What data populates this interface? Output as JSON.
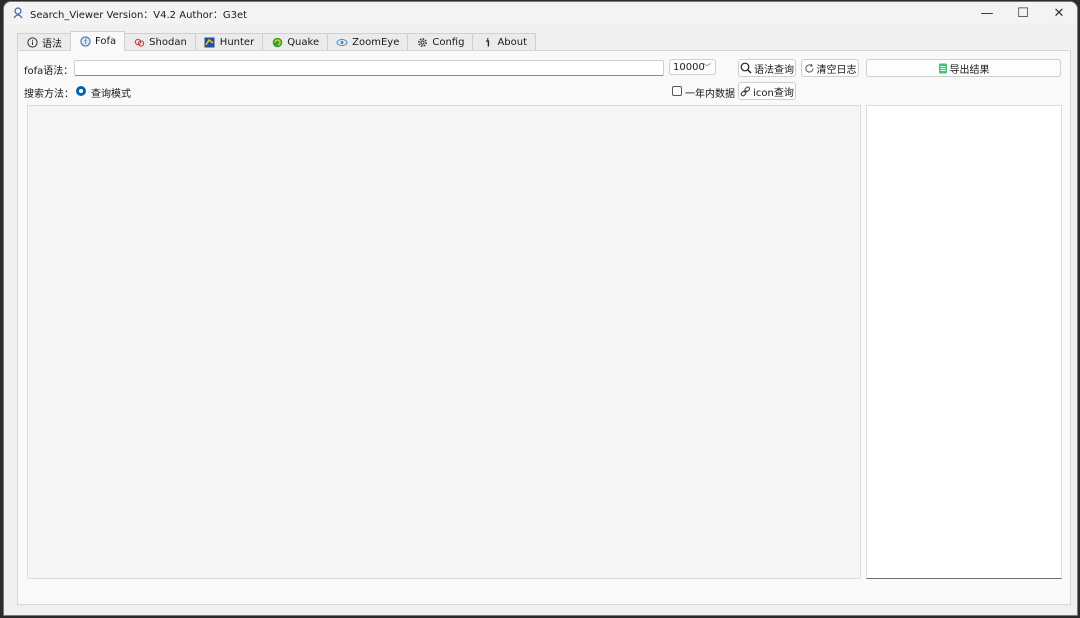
{
  "window": {
    "title": "Search_Viewer  Version：V4.2  Author：G3et",
    "controls": {
      "minimize": "—",
      "maximize": "☐",
      "close": "✕"
    }
  },
  "tabs": [
    {
      "label": "语法",
      "icon": "info-icon",
      "active": false
    },
    {
      "label": "Fofa",
      "icon": "fofa-icon",
      "active": true
    },
    {
      "label": "Shodan",
      "icon": "shodan-icon",
      "active": false
    },
    {
      "label": "Hunter",
      "icon": "hunter-icon",
      "active": false
    },
    {
      "label": "Quake",
      "icon": "quake-icon",
      "active": false
    },
    {
      "label": "ZoomEye",
      "icon": "zoomeye-icon",
      "active": false
    },
    {
      "label": "Config",
      "icon": "gear-icon",
      "active": false
    },
    {
      "label": "About",
      "icon": "about-icon",
      "active": false
    }
  ],
  "fofa": {
    "query_label": "fofa语法：",
    "query_value": "",
    "size_value": "10000",
    "search_button": "语法查询",
    "clear_button": "清空日志",
    "export_button": "导出结果",
    "method_label": "搜索方法：",
    "mode_radio": "查询模式",
    "one_year_checkbox": "一年内数据",
    "icon_button": "icon查询"
  },
  "colors": {
    "accent": "#0063b1",
    "export_icon": "#2ecc71"
  }
}
